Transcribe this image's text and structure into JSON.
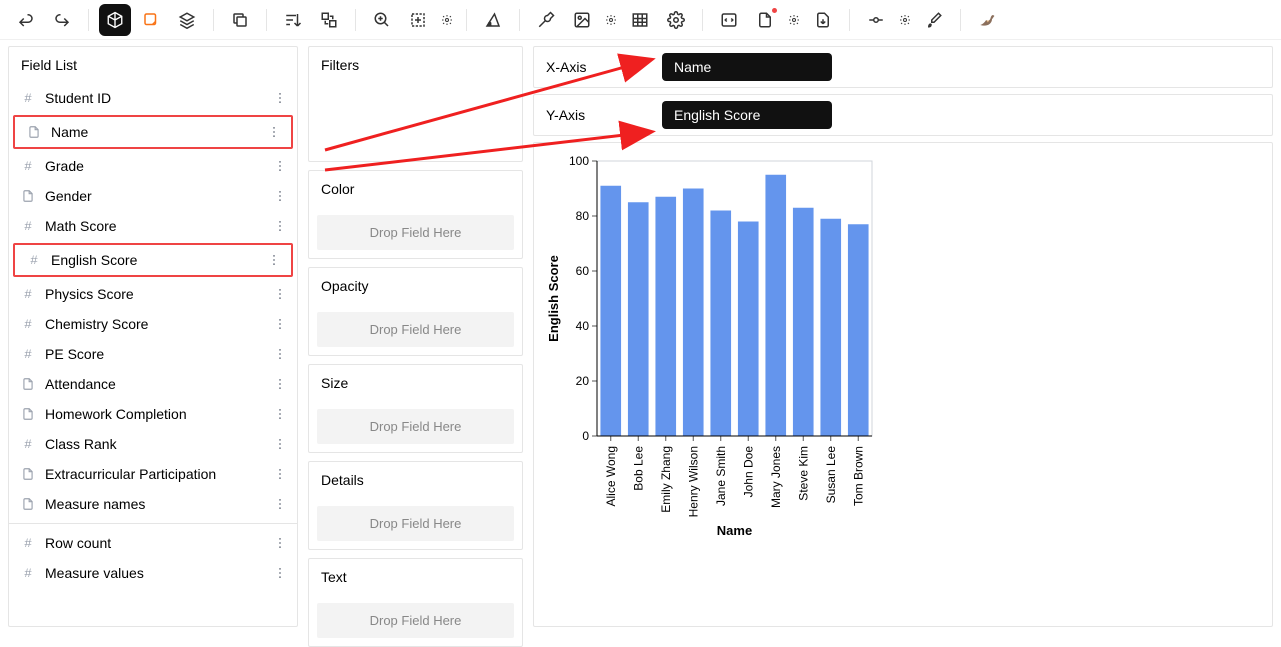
{
  "toolbar": {
    "tooltip": ""
  },
  "field_list": {
    "title": "Field List",
    "items": [
      {
        "icon": "hash",
        "label": "Student ID"
      },
      {
        "icon": "doc",
        "label": "Name",
        "highlight": true
      },
      {
        "icon": "hash",
        "label": "Grade"
      },
      {
        "icon": "doc",
        "label": "Gender"
      },
      {
        "icon": "hash",
        "label": "Math Score"
      },
      {
        "icon": "hash",
        "label": "English Score",
        "highlight": true
      },
      {
        "icon": "hash",
        "label": "Physics Score"
      },
      {
        "icon": "hash",
        "label": "Chemistry Score"
      },
      {
        "icon": "hash",
        "label": "PE Score"
      },
      {
        "icon": "doc",
        "label": "Attendance"
      },
      {
        "icon": "doc",
        "label": "Homework Completion"
      },
      {
        "icon": "hash",
        "label": "Class Rank"
      },
      {
        "icon": "doc",
        "label": "Extracurricular Participation"
      },
      {
        "icon": "doc",
        "label": "Measure names"
      }
    ],
    "extra": [
      {
        "icon": "hash",
        "label": "Row count"
      },
      {
        "icon": "hash",
        "label": "Measure values"
      }
    ]
  },
  "shelves": {
    "filters": "Filters",
    "color": "Color",
    "opacity": "Opacity",
    "size": "Size",
    "details": "Details",
    "text": "Text",
    "drop_text": "Drop Field Here"
  },
  "axes": {
    "x_label": "X-Axis",
    "y_label": "Y-Axis",
    "x_pill": "Name",
    "y_pill": "English Score"
  },
  "chart_data": {
    "type": "bar",
    "title": "",
    "xlabel": "Name",
    "ylabel": "English Score",
    "ylim": [
      0,
      100
    ],
    "yticks": [
      0,
      20,
      40,
      60,
      80,
      100
    ],
    "categories": [
      "Alice Wong",
      "Bob Lee",
      "Emily Zhang",
      "Henry Wilson",
      "Jane Smith",
      "John Doe",
      "Mary Jones",
      "Steve Kim",
      "Susan Lee",
      "Tom Brown"
    ],
    "values": [
      91,
      85,
      87,
      90,
      82,
      78,
      95,
      83,
      79,
      77
    ],
    "bar_color": "#6495ed"
  }
}
